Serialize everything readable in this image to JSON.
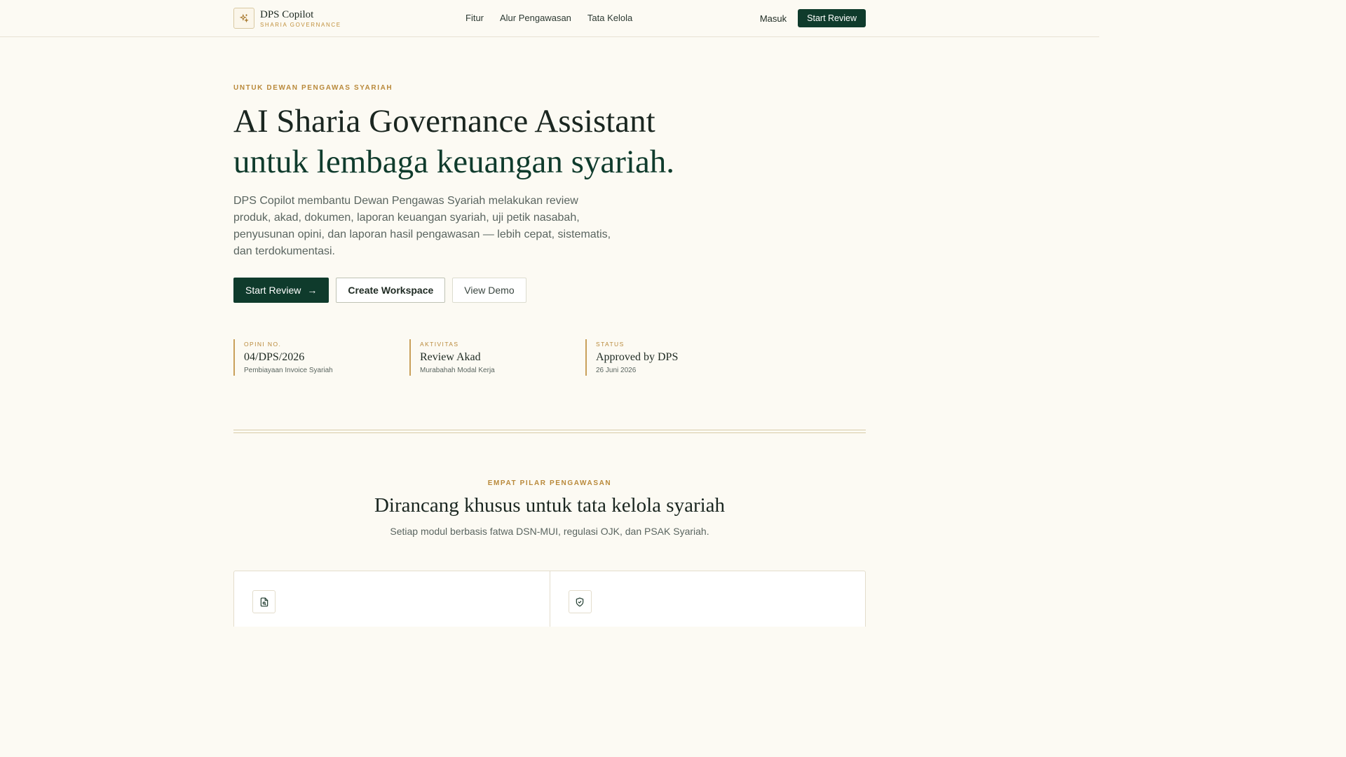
{
  "nav": {
    "brand_name": "DPS Copilot",
    "brand_sub": "SHARIA GOVERNANCE",
    "links": [
      "Fitur",
      "Alur Pengawasan",
      "Tata Kelola"
    ],
    "login": "Masuk",
    "cta": "Start Review"
  },
  "hero": {
    "eyebrow": "UNTUK DEWAN PENGAWAS SYARIAH",
    "title_line1": "AI Sharia Governance Assistant",
    "title_line2": "untuk lembaga keuangan syariah.",
    "description": "DPS Copilot membantu Dewan Pengawas Syariah melakukan review produk, akad, dokumen, laporan keuangan syariah, uji petik nasabah, penyusunan opini, dan laporan hasil pengawasan — lebih cepat, sistematis, dan terdokumentasi.",
    "btn_start": "Start Review",
    "btn_workspace": "Create Workspace",
    "btn_demo": "View Demo"
  },
  "stats": [
    {
      "label": "OPINI NO.",
      "value": "04/DPS/2026",
      "sub": "Pembiayaan Invoice Syariah"
    },
    {
      "label": "AKTIVITAS",
      "value": "Review Akad",
      "sub": "Murabahah Modal Kerja"
    },
    {
      "label": "STATUS",
      "value": "Approved by DPS",
      "sub": "26 Juni 2026"
    }
  ],
  "section": {
    "eyebrow": "EMPAT PILAR PENGAWASAN",
    "title": "Dirancang khusus untuk tata kelola syariah",
    "subtitle": "Setiap modul berbasis fatwa DSN-MUI, regulasi OJK, dan PSAK Syariah."
  },
  "colors": {
    "primary": "#0f3b2c",
    "accent": "#b9893a",
    "background": "#fcfaf3"
  },
  "icons": {
    "brand": "sparkle-icon",
    "arrow": "arrow-right-icon",
    "card1": "file-search-icon",
    "card2": "shield-check-icon"
  }
}
